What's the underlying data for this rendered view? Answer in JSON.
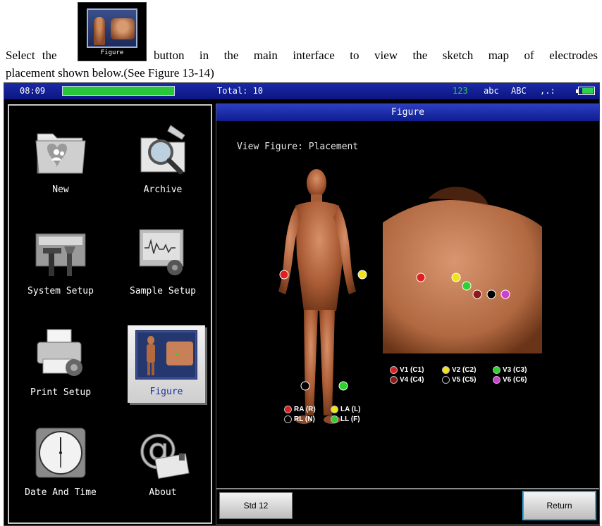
{
  "document": {
    "thumb_label": "Figure",
    "line1_left": "Select the",
    "line1_right": "button in the main interface to view the sketch map of electrodes",
    "line2": "placement shown below.(See Figure 13-14)"
  },
  "statusbar": {
    "time": "08:09",
    "progress": 1.0,
    "total": "Total: 10",
    "input_modes": [
      "123",
      "abc",
      "ABC",
      ",.:"
    ],
    "active_mode": "123"
  },
  "menu": {
    "items": [
      {
        "label": "New",
        "icon": "folder-user-icon"
      },
      {
        "label": "Archive",
        "icon": "magnifier-folder-icon"
      },
      {
        "label": "System Setup",
        "icon": "toolbox-icon"
      },
      {
        "label": "Sample Setup",
        "icon": "monitor-gear-icon"
      },
      {
        "label": "Print Setup",
        "icon": "printer-icon"
      },
      {
        "label": "Figure",
        "icon": "figure-thumbnail-icon"
      },
      {
        "label": "Date And Time",
        "icon": "clock-icon"
      },
      {
        "label": "About",
        "icon": "at-sign-icon"
      }
    ],
    "selected": "Figure"
  },
  "panel": {
    "title": "Figure",
    "view_text": "View Figure: Placement",
    "limb_legend": [
      {
        "label": "RA (R)",
        "color": "#e02020"
      },
      {
        "label": "LA (L)",
        "color": "#f2e21a"
      },
      {
        "label": "RL (N)",
        "color": "#000000"
      },
      {
        "label": "LL (F)",
        "color": "#2fd02f"
      }
    ],
    "chest_legend": [
      {
        "label": "V1 (C1)",
        "color": "#e02020"
      },
      {
        "label": "V2 (C2)",
        "color": "#f2e21a"
      },
      {
        "label": "V3 (C3)",
        "color": "#2fd02f"
      },
      {
        "label": "V4 (C4)",
        "color": "#8b1a1a"
      },
      {
        "label": "V5 (C5)",
        "color": "#000000"
      },
      {
        "label": "V6 (C6)",
        "color": "#d040d0"
      }
    ],
    "std_button": "Std 12",
    "return_button": "Return"
  }
}
